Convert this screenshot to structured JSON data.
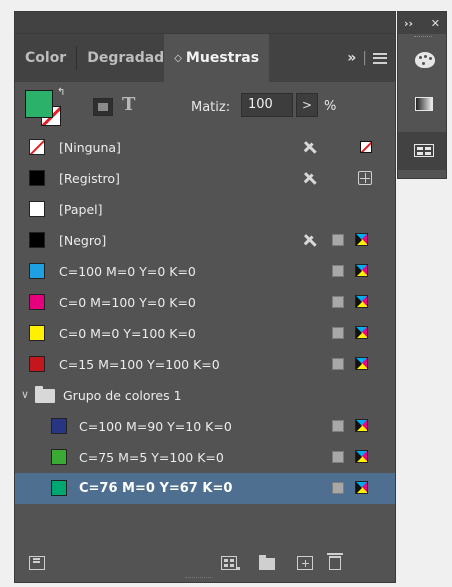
{
  "tabs": {
    "color": "Color",
    "degradado": "Degradad",
    "muestras_arrow": "◇",
    "muestras": "Muestras",
    "more": "»",
    "sep": "|"
  },
  "controls": {
    "tint_label": "Matiz:",
    "tint_value": "100",
    "tint_arrow": ">",
    "tint_unit": "%",
    "text_toggle": "T",
    "fill_color": "#2cb16b"
  },
  "swatches": [
    {
      "label": "[Ninguna]",
      "color": "none",
      "no_edit": true,
      "type": "none"
    },
    {
      "label": "[Registro]",
      "color": "#000000",
      "no_edit": true,
      "type": "registration"
    },
    {
      "label": "[Papel]",
      "color": "#ffffff",
      "no_edit": false,
      "type": ""
    },
    {
      "label": "[Negro]",
      "color": "#000000",
      "no_edit": true,
      "type": "cmyk"
    },
    {
      "label": "C=100 M=0 Y=0 K=0",
      "color": "#1ea0e3",
      "no_edit": false,
      "type": "cmyk"
    },
    {
      "label": "C=0 M=100 Y=0 K=0",
      "color": "#e6007e",
      "no_edit": false,
      "type": "cmyk"
    },
    {
      "label": "C=0 M=0 Y=100 K=0",
      "color": "#fff000",
      "no_edit": false,
      "type": "cmyk"
    },
    {
      "label": "C=15 M=100 Y=100 K=0",
      "color": "#c4161c",
      "no_edit": false,
      "type": "cmyk"
    }
  ],
  "group": {
    "label": "Grupo de colores 1",
    "chevron": "∨",
    "swatches": [
      {
        "label": "C=100 M=90 Y=10 K=0",
        "color": "#283583",
        "type": "cmyk"
      },
      {
        "label": "C=75 M=5 Y=100 K=0",
        "color": "#3aaa35",
        "type": "cmyk"
      },
      {
        "label": "C=76 M=0 Y=67 K=0",
        "color": "#00a86f",
        "type": "cmyk",
        "selected": true
      }
    ]
  },
  "dock": {
    "collapse": "››",
    "close": "✕"
  }
}
